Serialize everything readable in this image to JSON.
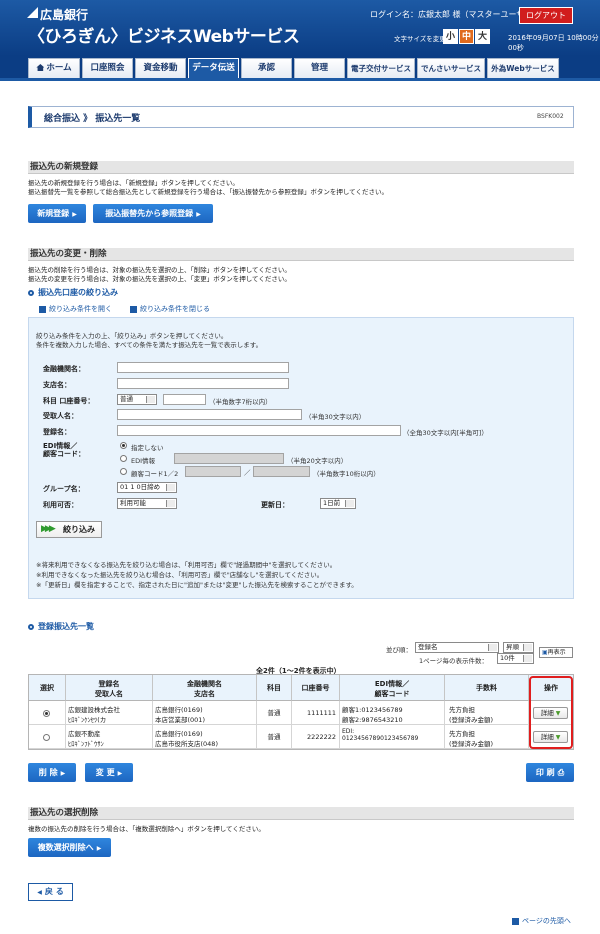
{
  "header": {
    "bank_name": "広島銀行",
    "service_name": "〈ひろぎん〉ビジネスWebサービス",
    "login_user": "ログイン名：広銀太郎 様（マスターユーザ）",
    "logout_label": "ログアウト",
    "font_size_label": "文字サイズを変更",
    "font_sizes": [
      "小",
      "中",
      "大"
    ],
    "datetime": "2016年09月07日 10時00分00秒"
  },
  "nav": {
    "tabs": [
      "ホーム",
      "口座照会",
      "資金移動",
      "データ伝送",
      "承認",
      "管理",
      "電子交付サービス",
      "でんさいサービス",
      "外為Webサービス"
    ],
    "active": "データ伝送"
  },
  "page": {
    "breadcrumb": "総合振込 》 振込先一覧",
    "screen_code": "BSFK002"
  },
  "new_reg": {
    "title": "振込先の新規登録",
    "desc1": "振込先の新規登録を行う場合は、「新規登録」ボタンを押してください。",
    "desc2": "振込振替先一覧を参照して総合振込先として新規登録を行う場合は、「振込振替先から参照登録」ボタンを押してください。",
    "new_button": "新規登録",
    "ref_button": "振込振替先から参照登録"
  },
  "edit": {
    "title": "振込先の変更・削除",
    "desc1": "振込先の削除を行う場合は、対象の振込先を選択の上、「削除」ボタンを押してください。",
    "desc2": "振込先の変更を行う場合は、対象の振込先を選択の上、「変更」ボタンを押してください。",
    "filter_title": "振込先口座の絞り込み",
    "open_link": "絞り込み条件を開く",
    "close_link": "絞り込み条件を閉じる"
  },
  "filter": {
    "intro1": "絞り込み条件を入力の上、「絞り込み」ボタンを押してください。",
    "intro2": "条件を複数入力した場合、すべての条件を満たす振込先を一覧で表示します。",
    "bank_label": "金融機関名：",
    "branch_label": "支店名：",
    "account_label": "科目 口座番号：",
    "account_type": "普通",
    "account_hint": "（半角数字7桁以内）",
    "recipient_label": "受取人名：",
    "recipient_hint": "（半角30文字以内）",
    "regname_label": "登録名：",
    "regname_hint": "（全角30文字以内[半角可]）",
    "edi_label1": "EDI情報／",
    "edi_label2": "顧客コード：",
    "opt_none": "指定しない",
    "opt_edi": "EDI情報",
    "edi_hint": "（半角20文字以内）",
    "opt_customer": "顧客コード1／2",
    "slash": "／",
    "customer_hint": "（半角数字10桁以内）",
    "group_label": "グループ名：",
    "group_value": "01 1 0日締め",
    "usable_label": "利用可否：",
    "usable_value": "利用可能",
    "updated_label": "更新日：",
    "updated_value": "1日前",
    "filter_button": "絞り込み",
    "note1": "※将来利用できなくなる振込先を絞り込む場合は、「利用可否」欄で\"経過期間中\"を選択してください。",
    "note2": "※利用できなくなった振込先を絞り込む場合は、「利用可否」欄で\"店舗なし\"を選択してください。",
    "note3": "※「更新日」欄を指定することで、指定された日に\"追加\"または\"変更\"した振込先を検索することができます。"
  },
  "list": {
    "title": "登録振込先一覧",
    "sort_label": "並び順：",
    "sort_value": "登録名",
    "order_value": "昇順",
    "per_page_label": "1ページ毎の表示件数：",
    "per_page_value": "10件",
    "redisplay_label": "再表示",
    "count": "全2件（1〜2件を表示中）",
    "headers": {
      "select": "選択",
      "regname1": "登録名",
      "regname2": "受取人名",
      "bank1": "金融機関名",
      "bank2": "支店名",
      "type": "科目",
      "account": "口座番号",
      "edi1": "EDI情報／",
      "edi2": "顧客コード",
      "fee": "手数料",
      "action": "操作"
    },
    "rows": [
      {
        "regname": "広銀建設株式会社",
        "recipient": "ﾋﾛｷﾞﾝｹﾝｾﾂ(カ",
        "bank": "広島銀行(0169)",
        "branch": "本店営業部(001)",
        "type": "普通",
        "account": "1111111",
        "edi1": "顧客1:0123456789",
        "edi2": "顧客2:9876543210",
        "fee1": "先方負担",
        "fee2": "(登録済み金額)",
        "detail": "詳細"
      },
      {
        "regname": "広銀不動産",
        "recipient": "ﾋﾛｷﾞﾝﾌﾄﾞｳｻﾝ",
        "bank": "広島銀行(0169)",
        "branch": "広島市役所支店(048)",
        "type": "普通",
        "account": "2222222",
        "edi1": "EDI:",
        "edi2": "01234567890123456789",
        "fee1": "先方負担",
        "fee2": "(登録済み金額)",
        "detail": "詳細"
      }
    ]
  },
  "actions": {
    "delete": "削 除",
    "change": "変 更",
    "print": "印 刷"
  },
  "multi": {
    "title": "振込先の選択削除",
    "desc": "複数の振込先の削除を行う場合は、「複数選択削除へ」ボタンを押してください。",
    "button": "複数選択削除へ"
  },
  "footer": {
    "back": "戻 る",
    "top_link": "ページの先頭へ"
  },
  "colors": {
    "header": "#1d5aa5",
    "button": "#1d66c1",
    "logout": "#d11d1d",
    "highlight": "#e01e1e"
  }
}
